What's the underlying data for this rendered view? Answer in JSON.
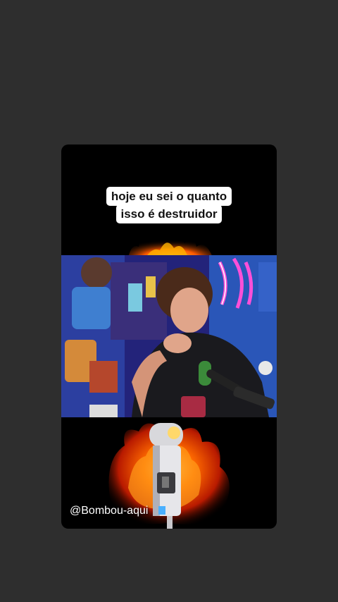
{
  "caption": {
    "line1": "hoje eu sei o quanto",
    "line2": "isso é destruidor"
  },
  "watermark": "@Bombou-aqui",
  "colors": {
    "page_background": "#2e2e2e",
    "card_background": "#000000",
    "caption_background": "#ffffff",
    "flame_orange": "#ff5a00",
    "neon_blue": "#3a7bff",
    "neon_pink": "#ff4fd8"
  }
}
